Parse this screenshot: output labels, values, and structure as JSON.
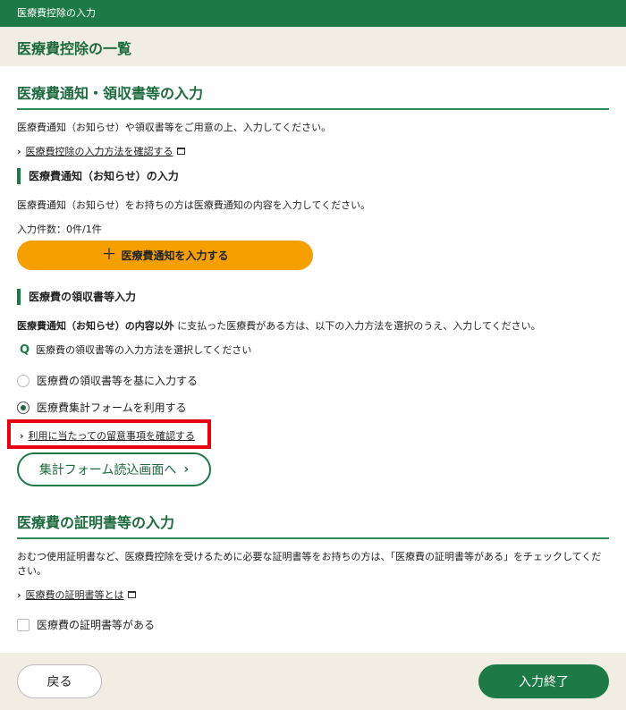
{
  "topbar": {
    "title": "医療費控除の入力"
  },
  "page": {
    "title": "医療費控除の一覧"
  },
  "section1": {
    "heading": "医療費通知・領収書等の入力",
    "intro": "医療費通知（お知らせ）や領収書等をご用意の上、入力してください。",
    "howto_link": "医療費控除の入力方法を確認する",
    "notice": {
      "heading": "医療費通知（お知らせ）の入力",
      "desc": "医療費通知（お知らせ）をお持ちの方は医療費通知の内容を入力してください。",
      "count": "入力件数：0件/1件",
      "button": "医療費通知を入力する"
    },
    "receipt": {
      "heading": "医療費の領収書等入力",
      "desc_bold": "医療費通知（お知らせ）の内容以外",
      "desc_rest": "に支払った医療費がある方は、以下の入力方法を選択のうえ、入力してください。",
      "question_mark": "Q",
      "question": "医療費の領収書等の入力方法を選択してください",
      "options": [
        {
          "label": "医療費の領収書等を基に入力する",
          "selected": false
        },
        {
          "label": "医療費集計フォームを利用する",
          "selected": true
        }
      ],
      "notes_link": "利用に当たっての留意事項を確認する",
      "form_button": "集計フォーム読込画面へ"
    }
  },
  "section2": {
    "heading": "医療費の証明書等の入力",
    "desc_line1": "おむつ使用証明書など、医療費控除を受けるために必要な証明書等をお持ちの方は、「医療費の証明書等がある」をチェックしてくだ",
    "desc_line2": "さい。",
    "what_link": "医療費の証明書等とは",
    "checkbox_label": "医療費の証明書等がある"
  },
  "footer": {
    "back": "戻る",
    "finish": "入力終了"
  },
  "colors": {
    "brand_green": "#1d7a46",
    "accent_orange": "#f5a000",
    "highlight_red": "#e60012",
    "panel_beige": "#f1ede3"
  }
}
